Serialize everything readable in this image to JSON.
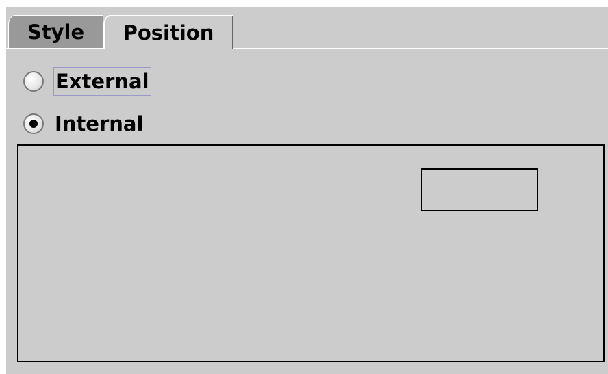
{
  "tabs": [
    {
      "label": "Style",
      "selected": false
    },
    {
      "label": "Position",
      "selected": true
    }
  ],
  "position": {
    "options": [
      {
        "label": "External",
        "checked": false
      },
      {
        "label": "Internal",
        "checked": true
      }
    ]
  }
}
